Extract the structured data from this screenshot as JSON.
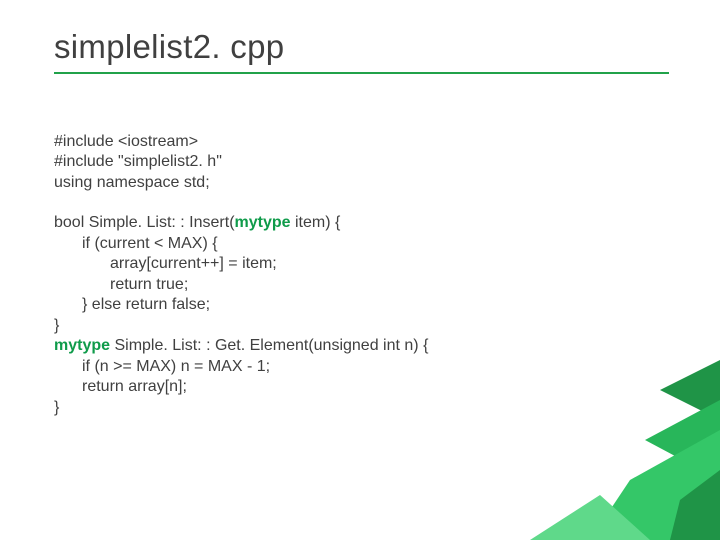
{
  "title": "simplelist2. cpp",
  "code": {
    "l1": "#include <iostream>",
    "l2": "#include \"simplelist2. h\"",
    "l3": "using namespace std;",
    "l4a": "bool Simple. List: : Insert(",
    "l4kw": "mytype",
    "l4b": " item) {",
    "l5": "if (current < MAX) {",
    "l6": "array[current++] = item;",
    "l7": "return true;",
    "l8": "} else return false;",
    "l9": "}",
    "l10kw": "mytype",
    "l10b": " Simple. List: : Get. Element(unsigned int n) {",
    "l11": "if (n >= MAX) n = MAX - 1;",
    "l12": "return array[n];",
    "l13": "}"
  }
}
